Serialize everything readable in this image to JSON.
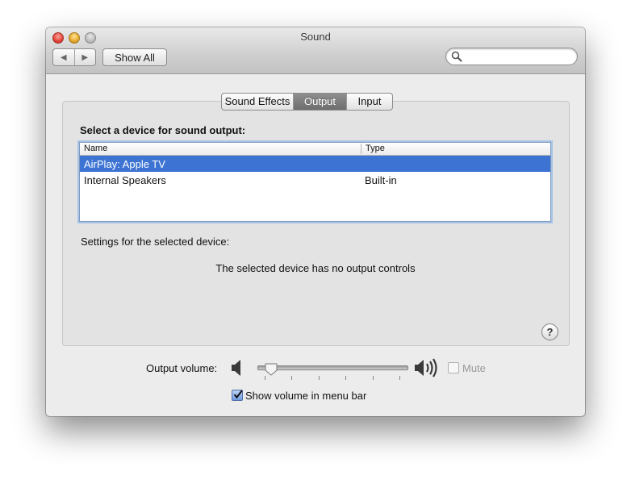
{
  "window": {
    "title": "Sound"
  },
  "toolbar": {
    "back_icon": "chevron-left-icon",
    "forward_icon": "chevron-right-icon",
    "back_glyph": "◀",
    "forward_glyph": "▶",
    "show_all_label": "Show All",
    "search_placeholder": "",
    "search_value": ""
  },
  "tabs": [
    {
      "label": "Sound Effects",
      "active": false
    },
    {
      "label": "Output",
      "active": true
    },
    {
      "label": "Input",
      "active": false
    }
  ],
  "output": {
    "select_label": "Select a device for sound output:",
    "columns": {
      "name": "Name",
      "type": "Type"
    },
    "devices": [
      {
        "name": "AirPlay: Apple TV",
        "type": "",
        "selected": true
      },
      {
        "name": "Internal Speakers",
        "type": "Built-in",
        "selected": false
      }
    ],
    "settings_label": "Settings for the selected device:",
    "no_controls_message": "The selected device has no output controls",
    "help_glyph": "?"
  },
  "volume": {
    "label": "Output volume:",
    "level": 0.05,
    "tick_count": 6,
    "mute_label": "Mute",
    "mute_checked": false,
    "mute_enabled": false,
    "show_in_menu_label": "Show volume in menu bar",
    "show_in_menu_checked": true
  },
  "colors": {
    "selection": "#3d74d3",
    "focus_ring": "#a9c3e6"
  }
}
